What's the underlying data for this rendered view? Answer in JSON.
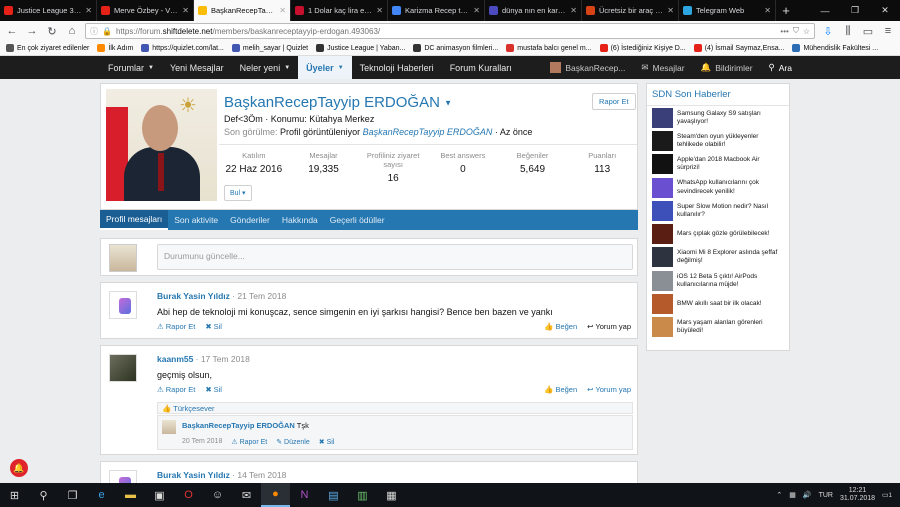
{
  "browser": {
    "tabs": [
      {
        "title": "Justice League 3. Se",
        "color": "#e62117"
      },
      {
        "title": "Merve Özbey - Vuru",
        "color": "#e62117"
      },
      {
        "title": "BaşkanRecepTayyip",
        "color": "#fbbc05",
        "active": true
      },
      {
        "title": "1 Dolar kaç lira ede",
        "color": "#c8102e"
      },
      {
        "title": "Karizma Recep tayy",
        "color": "#4285f4"
      },
      {
        "title": "dünya nın en karizm",
        "color": "#4b4bbf"
      },
      {
        "title": "Ücretsiz bir araç mu",
        "color": "#d84315"
      },
      {
        "title": "Telegram Web",
        "color": "#2ca5e0"
      }
    ],
    "url_prefix": "https://forum.",
    "url_domain": "shiftdelete.net",
    "url_rest": "/members/baskanreceptayyip-erdogan.493063/",
    "bookmarks": [
      {
        "label": "En çok ziyaret edilenler",
        "icon": "gear-icon"
      },
      {
        "label": "İlk Adım",
        "icon": "firefox-icon"
      },
      {
        "label": "https://quizlet.com/lat...",
        "icon": "quizlet-icon"
      },
      {
        "label": "melih_sayar | Quizlet",
        "icon": "quizlet-icon"
      },
      {
        "label": "Justice League | Yaban...",
        "icon": "spider-icon"
      },
      {
        "label": "DC animasyon filmleri...",
        "icon": "spider-icon"
      },
      {
        "label": "mustafa balcı genel m...",
        "icon": "pdf-icon"
      },
      {
        "label": "(6) İstediğiniz Kişiye D...",
        "icon": "youtube-icon"
      },
      {
        "label": "(4) İsmail Saymaz,Ensa...",
        "icon": "youtube-icon"
      },
      {
        "label": "Mühendislik Fakültesi ...",
        "icon": "school-icon"
      }
    ]
  },
  "site_nav": {
    "left": [
      {
        "label": "Forumlar",
        "dropdown": true
      },
      {
        "label": "Yeni Mesajlar",
        "dropdown": false
      },
      {
        "label": "Neler yeni",
        "dropdown": true
      },
      {
        "label": "Üyeler",
        "dropdown": true,
        "active": true
      },
      {
        "label": "Teknoloji Haberleri",
        "dropdown": false
      },
      {
        "label": "Forum Kuralları",
        "dropdown": false
      }
    ],
    "user": "BaşkanRecep...",
    "messages": "Mesajlar",
    "alerts": "Bildirimler",
    "search": "Ara"
  },
  "profile": {
    "name": "BaşkanRecepTayyip ERDOĞAN",
    "report": "Rapor Et",
    "custom_title": "Def<3Öm · Konumu: Kütahya Merkez",
    "last_seen_label": "Son görülme:",
    "last_seen_text": "Profil görüntüleniyor",
    "last_seen_user": "BaşkanRecepTayyip ERDOĞAN",
    "last_seen_time": "· Az önce",
    "stats": [
      {
        "label": "Katılım",
        "value": "22 Haz 2016"
      },
      {
        "label": "Mesajlar",
        "value": "19,335"
      },
      {
        "label": "Profiliniz ziyaret sayısı",
        "value": "16"
      },
      {
        "label": "Best answers",
        "value": "0"
      },
      {
        "label": "Beğeniler",
        "value": "5,649"
      },
      {
        "label": "Puanları",
        "value": "113"
      }
    ],
    "find": "Bul ▾",
    "tabs": [
      "Profil mesajları",
      "Son aktivite",
      "Gönderiler",
      "Hakkında",
      "Geçerli ödüller"
    ]
  },
  "status_placeholder": "Durumunu güncelle...",
  "messages": [
    {
      "user": "Burak Yasin Yıldız",
      "date": "· 21 Tem 2018",
      "text": "Abi hep de teknoloji mi konuşcaz, sence simgenin en iyi şarkısı hangisi? Bence ben bazen ve yankı",
      "report": "Rapor Et",
      "delete": "Sil",
      "like": "Beğen",
      "reply": "Yorum yap"
    },
    {
      "user": "kaanm55",
      "date": "· 17 Tem 2018",
      "text": "geçmiş olsun,",
      "report": "Rapor Et",
      "delete": "Sil",
      "like": "Beğen",
      "reply": "Yorum yap",
      "liked_by": "Türkçesever",
      "comment": {
        "user": "BaşkanRecepTayyip ERDOĞAN",
        "text": "Tşk",
        "date": "20 Tem 2018",
        "report": "Rapor Et",
        "edit": "Düzenle",
        "delete": "Sil"
      }
    },
    {
      "user": "Burak Yasin Yıldız",
      "date": "· 14 Tem 2018"
    }
  ],
  "sidebar": {
    "heading": "SDN Son Haberler",
    "items": [
      {
        "text": "Samsung Galaxy S9 satışları yavaşlıyor!",
        "color": "#3a3f7a"
      },
      {
        "text": "Steam'den oyun yükleyenler tehlikede olabilir!",
        "color": "#1a1a1a"
      },
      {
        "text": "Apple'dan 2018 Macbook Air sürprizi!",
        "color": "#111111"
      },
      {
        "text": "WhatsApp kullanıcılarını çok sevindirecek yenilik!",
        "color": "#6a4fd1"
      },
      {
        "text": "Super Slow Motion nedir? Nasıl kullanılır?",
        "color": "#3d4fb8"
      },
      {
        "text": "Mars çıplak gözle görülebilecek!",
        "color": "#5a1f12"
      },
      {
        "text": "Xiaomi Mi 8 Explorer aslında şeffaf değilmiş!",
        "color": "#2d3440"
      },
      {
        "text": "iOS 12 Beta 5 çıktı! AirPods kullanıcılarına müjde!",
        "color": "#8a8f96"
      },
      {
        "text": "BMW akıllı saat bir ilk olacak!",
        "color": "#b55a2b"
      },
      {
        "text": "Mars yaşam alanları görenleri büyüledi!",
        "color": "#c98a4a"
      }
    ]
  },
  "taskbar": {
    "lang": "TUR",
    "time": "12:21",
    "date": "31.07.2018",
    "notif_count": "1"
  }
}
